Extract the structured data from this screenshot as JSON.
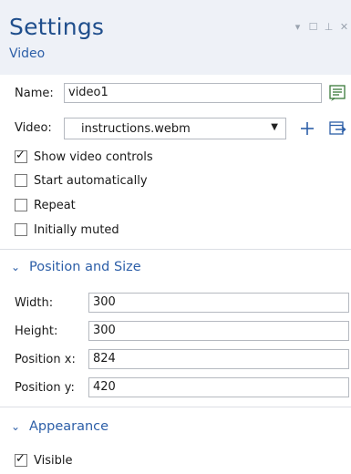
{
  "header": {
    "title": "Settings",
    "subtitle": "Video",
    "controls": {
      "menu": "▾",
      "maximize": "☐",
      "pin": "⊥",
      "close": "✕"
    }
  },
  "name": {
    "label": "Name:",
    "value": "video1",
    "button_icon": "label-edit-icon"
  },
  "video": {
    "label": "Video:",
    "selected": "instructions.webm",
    "add_icon": "plus-icon",
    "browse_icon": "import-file-icon"
  },
  "options": [
    {
      "label": "Show video controls",
      "checked": true
    },
    {
      "label": "Start automatically",
      "checked": false
    },
    {
      "label": "Repeat",
      "checked": false
    },
    {
      "label": "Initially muted",
      "checked": false
    }
  ],
  "position_size": {
    "title": "Position and Size",
    "fields": [
      {
        "label": "Width:",
        "value": "300"
      },
      {
        "label": "Height:",
        "value": "300"
      },
      {
        "label": "Position x:",
        "value": "824"
      },
      {
        "label": "Position y:",
        "value": "420"
      }
    ]
  },
  "appearance": {
    "title": "Appearance",
    "visible": {
      "label": "Visible",
      "checked": true
    }
  },
  "colors": {
    "title": "#1f4e8c",
    "accent": "#2d5fa8",
    "header_bg": "#eef1f7"
  }
}
